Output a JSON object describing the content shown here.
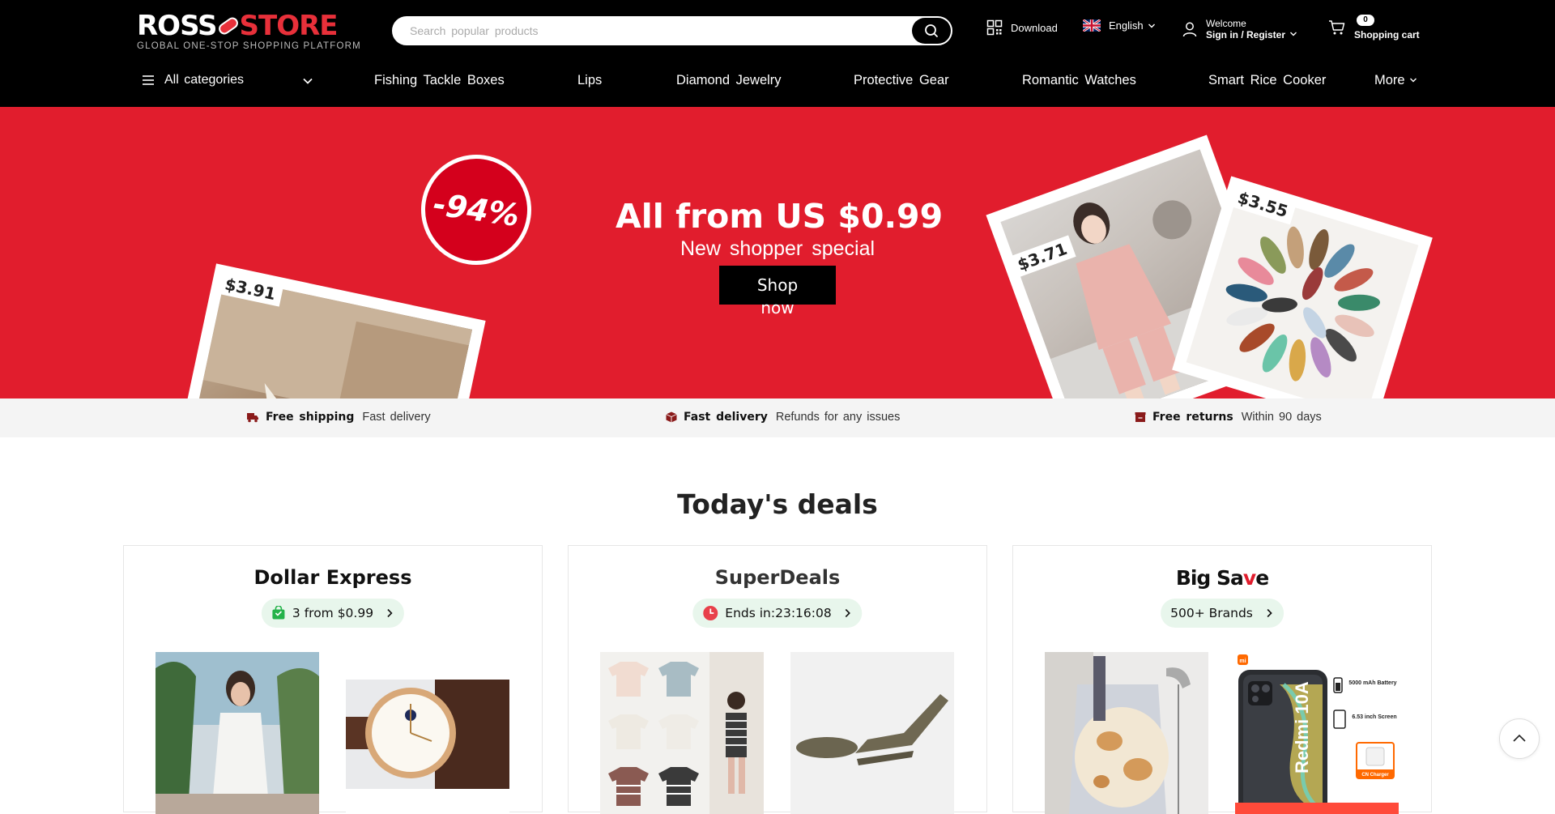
{
  "header": {
    "logo_left": "ROSS",
    "logo_right": "STORE",
    "logo_tagline": "GLOBAL ONE-STOP SHOPPING PLATFORM",
    "search_placeholder": "Search popular products",
    "download_label": "Download",
    "language_label": "English",
    "account_welcome": "Welcome",
    "account_action": "Sign in / Register",
    "cart_count": "0",
    "cart_label": "Shopping cart"
  },
  "nav": {
    "all_categories": "All categories",
    "links": [
      "Fishing Tackle Boxes",
      "Lips",
      "Diamond Jewelry",
      "Protective Gear",
      "Romantic Watches",
      "Smart Rice Cooker"
    ],
    "more_label": "More"
  },
  "hero": {
    "title": "All from US $0.99",
    "subtitle": "New shopper special",
    "button_label": "Shop now",
    "discount_badge": "-94%",
    "price_tags": [
      "$3.91",
      "$3.71",
      "$3.55"
    ],
    "background_color": "#e11d2d"
  },
  "benefits": [
    {
      "title": "Free shipping",
      "desc": "Fast delivery"
    },
    {
      "title": "Fast delivery",
      "desc": "Refunds for any issues"
    },
    {
      "title": "Free returns",
      "desc": "Within 90 days"
    }
  ],
  "deals": {
    "section_title": "Today's deals",
    "cards": [
      {
        "title": "Dollar Express",
        "pill": "3 from $0.99"
      },
      {
        "title": "SuperDeals",
        "pill": "Ends in:23:16:08"
      },
      {
        "title_big": "Big Sa",
        "title_v": "v",
        "title_end": "e",
        "pill": "500+ Brands"
      }
    ],
    "product_labels": {
      "phone_model": "Redmi 10A",
      "battery": "5000 mAh Battery",
      "screen": "6.53 inch Screen",
      "charger": "CN Charger"
    }
  },
  "colors": {
    "brand_red": "#e11d2d",
    "header_bg": "#000000",
    "pill_green": "#e8f6ec"
  }
}
